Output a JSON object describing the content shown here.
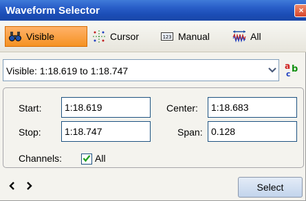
{
  "window": {
    "title": "Waveform Selector"
  },
  "toolbar": {
    "visible_label": "Visible",
    "cursor_label": "Cursor",
    "manual_label": "Manual",
    "all_label": "All"
  },
  "combo": {
    "value": "Visible:  1:18.619 to 1:18.747"
  },
  "fields": {
    "start_label": "Start:",
    "start_value": "1:18.619",
    "center_label": "Center:",
    "center_value": "1:18.683",
    "stop_label": "Stop:",
    "stop_value": "1:18.747",
    "span_label": "Span:",
    "span_value": "0.128"
  },
  "channels": {
    "label": "Channels:",
    "option_label": "All",
    "checked": true
  },
  "footer": {
    "select_label": "Select"
  },
  "colors": {
    "titlebar": "#2a5fc9",
    "active_tool": "#f59222"
  }
}
